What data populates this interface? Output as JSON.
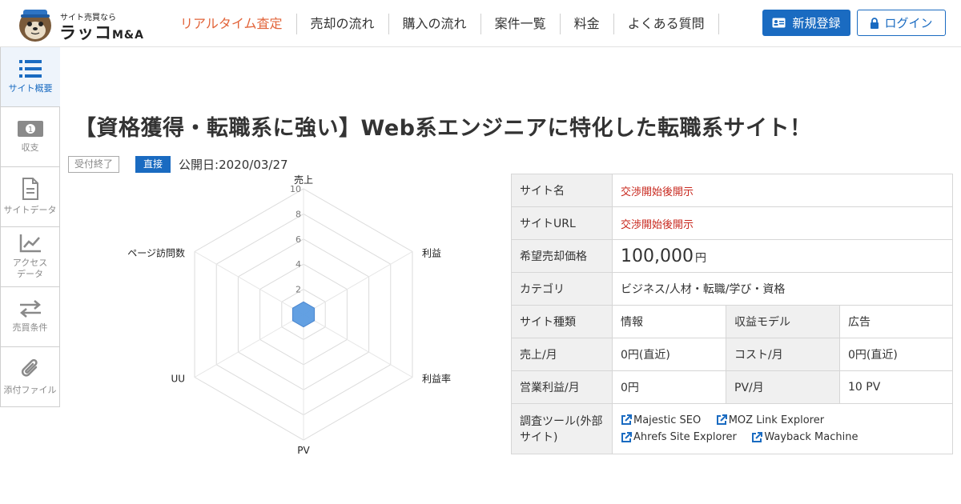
{
  "header": {
    "logo_tagline": "サイト売買なら",
    "logo_name": "ラッコ",
    "logo_suffix": "M&A",
    "nav": [
      {
        "label": "リアルタイム査定",
        "active": true
      },
      {
        "label": "売却の流れ",
        "active": false
      },
      {
        "label": "購入の流れ",
        "active": false
      },
      {
        "label": "案件一覧",
        "active": false
      },
      {
        "label": "料金",
        "active": false
      },
      {
        "label": "よくある質問",
        "active": false
      }
    ],
    "register_label": "新規登録",
    "login_label": "ログイン",
    "accent_color": "#1a6bc1",
    "active_nav_color": "#e2643a"
  },
  "sidebar": {
    "items": [
      {
        "label": "サイト概要",
        "icon": "list-icon",
        "active": true
      },
      {
        "label": "収支",
        "icon": "money-icon",
        "active": false
      },
      {
        "label": "サイトデータ",
        "icon": "document-icon",
        "active": false
      },
      {
        "label": "アクセス\nデータ",
        "icon": "chart-line-icon",
        "active": false
      },
      {
        "label": "売買条件",
        "icon": "exchange-icon",
        "active": false
      },
      {
        "label": "添付ファイル",
        "icon": "paperclip-icon",
        "active": false
      }
    ]
  },
  "listing": {
    "title": "【資格獲得・転職系に強い】Web系エンジニアに特化した転職系サイト！",
    "status_badge": "受付終了",
    "type_badge": "直接",
    "published": "公開日:2020/03/27"
  },
  "chart_data": {
    "type": "radar",
    "axes": [
      "売上",
      "利益",
      "利益率",
      "PV",
      "UU",
      "ページ訪問数"
    ],
    "ticks": [
      2,
      4,
      6,
      8,
      10
    ],
    "range": [
      0,
      10
    ],
    "values": [
      1,
      1,
      1,
      1,
      1,
      1
    ],
    "fill_color": "#5b9be0"
  },
  "info_table": {
    "site_name_label": "サイト名",
    "site_name_value": "交渉開始後開示",
    "site_url_label": "サイトURL",
    "site_url_value": "交渉開始後開示",
    "price_label": "希望売却価格",
    "price_value": "100,000",
    "price_unit": "円",
    "category_label": "カテゴリ",
    "category_value": "ビジネス/人材・転職/学び・資格",
    "site_type_label": "サイト種類",
    "site_type_value": "情報",
    "revenue_model_label": "収益モデル",
    "revenue_model_value": "広告",
    "sales_label": "売上/月",
    "sales_value": "0円(直近)",
    "cost_label": "コスト/月",
    "cost_value": "0円(直近)",
    "profit_label": "営業利益/月",
    "profit_value": "0円",
    "pv_label": "PV/月",
    "pv_value": "10 PV",
    "tools_label": "調査ツール(外部サイト)",
    "tools": [
      "Majestic SEO",
      "MOZ Link Explorer",
      "Ahrefs Site Explorer",
      "Wayback Machine"
    ]
  }
}
